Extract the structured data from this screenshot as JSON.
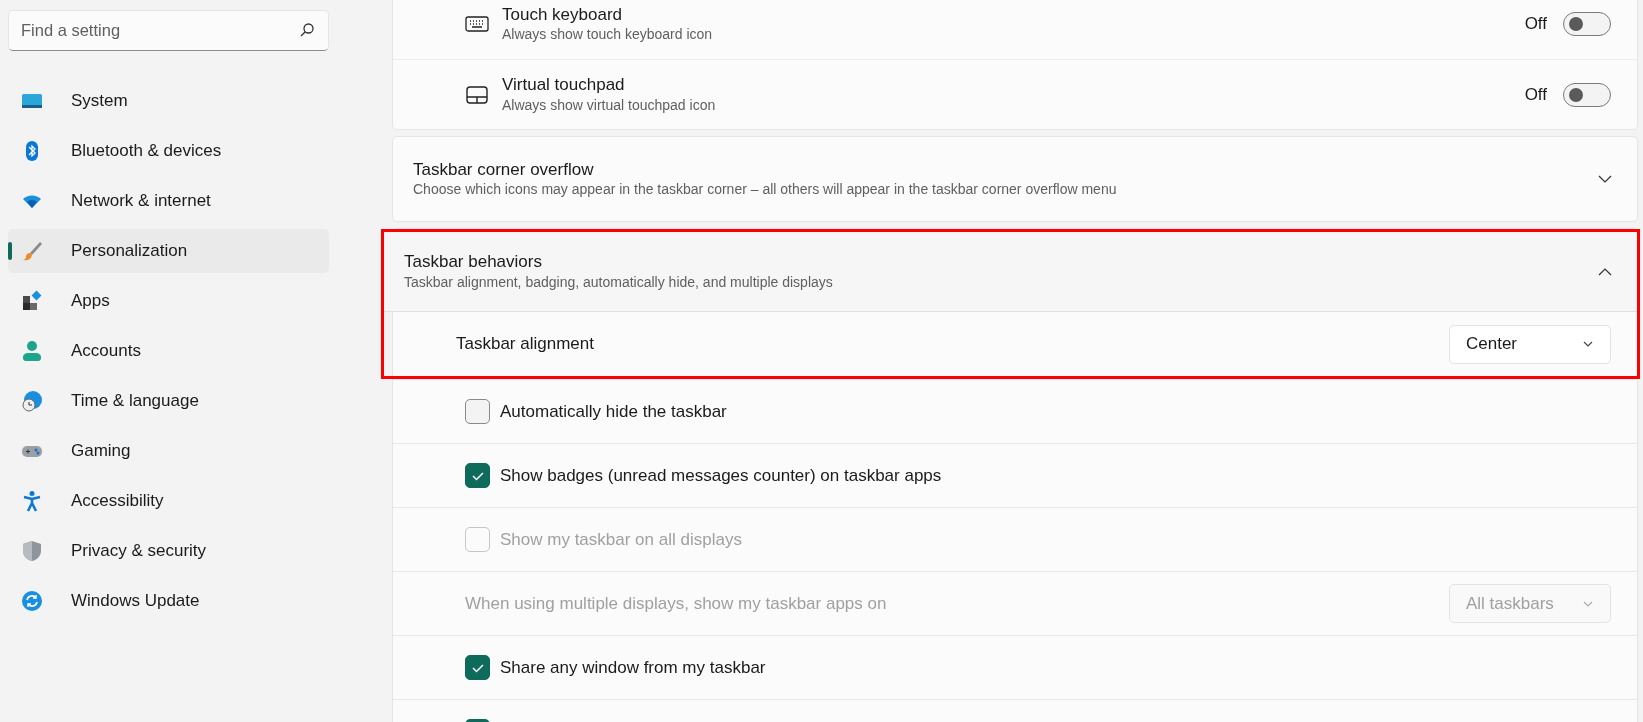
{
  "search": {
    "placeholder": "Find a setting"
  },
  "sidebar": {
    "items": [
      {
        "label": "System",
        "selected": false
      },
      {
        "label": "Bluetooth & devices",
        "selected": false
      },
      {
        "label": "Network & internet",
        "selected": false
      },
      {
        "label": "Personalization",
        "selected": true
      },
      {
        "label": "Apps",
        "selected": false
      },
      {
        "label": "Accounts",
        "selected": false
      },
      {
        "label": "Time & language",
        "selected": false
      },
      {
        "label": "Gaming",
        "selected": false
      },
      {
        "label": "Accessibility",
        "selected": false
      },
      {
        "label": "Privacy & security",
        "selected": false
      },
      {
        "label": "Windows Update",
        "selected": false
      }
    ]
  },
  "settings": [
    {
      "kind": "toggle-group",
      "rows": [
        {
          "title": "Touch keyboard",
          "subtitle": "Always show touch keyboard icon",
          "state_label": "Off",
          "on": false
        },
        {
          "title": "Virtual touchpad",
          "subtitle": "Always show virtual touchpad icon",
          "state_label": "Off",
          "on": false
        }
      ]
    },
    {
      "kind": "expander",
      "title": "Taskbar corner overflow",
      "subtitle": "Choose which icons may appear in the taskbar corner – all others will appear in the taskbar corner overflow menu",
      "expanded": false,
      "highlighted": false
    },
    {
      "kind": "expander",
      "title": "Taskbar behaviors",
      "subtitle": "Taskbar alignment, badging, automatically hide, and multiple displays",
      "expanded": true,
      "highlighted": true,
      "rows": [
        {
          "kind": "dropdown",
          "label": "Taskbar alignment",
          "value": "Center",
          "disabled": false,
          "highlighted": true
        },
        {
          "kind": "checkbox",
          "label": "Automatically hide the taskbar",
          "checked": false,
          "disabled": false,
          "highlighted": false
        },
        {
          "kind": "checkbox",
          "label": "Show badges (unread messages counter) on taskbar apps",
          "checked": true,
          "disabled": false,
          "highlighted": false
        },
        {
          "kind": "checkbox",
          "label": "Show my taskbar on all displays",
          "checked": false,
          "disabled": true,
          "highlighted": false
        },
        {
          "kind": "dropdown",
          "label": "When using multiple displays, show my taskbar apps on",
          "value": "All taskbars",
          "disabled": true,
          "highlighted": false
        },
        {
          "kind": "checkbox",
          "label": "Share any window from my taskbar",
          "checked": true,
          "disabled": false,
          "highlighted": false
        },
        {
          "kind": "checkbox",
          "checked": true,
          "disabled": false,
          "highlighted": false
        }
      ]
    }
  ]
}
